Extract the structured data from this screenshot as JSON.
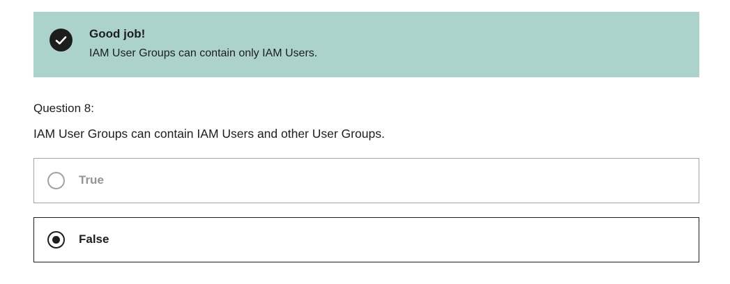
{
  "feedback": {
    "title": "Good job!",
    "message": "IAM User Groups can contain only IAM Users.",
    "icon": "check-circle-icon",
    "background_color": "#acd2cc"
  },
  "question": {
    "label": "Question 8:",
    "text": "IAM User Groups can contain IAM Users and other User Groups."
  },
  "options": [
    {
      "label": "True",
      "selected": false
    },
    {
      "label": "False",
      "selected": true
    }
  ]
}
